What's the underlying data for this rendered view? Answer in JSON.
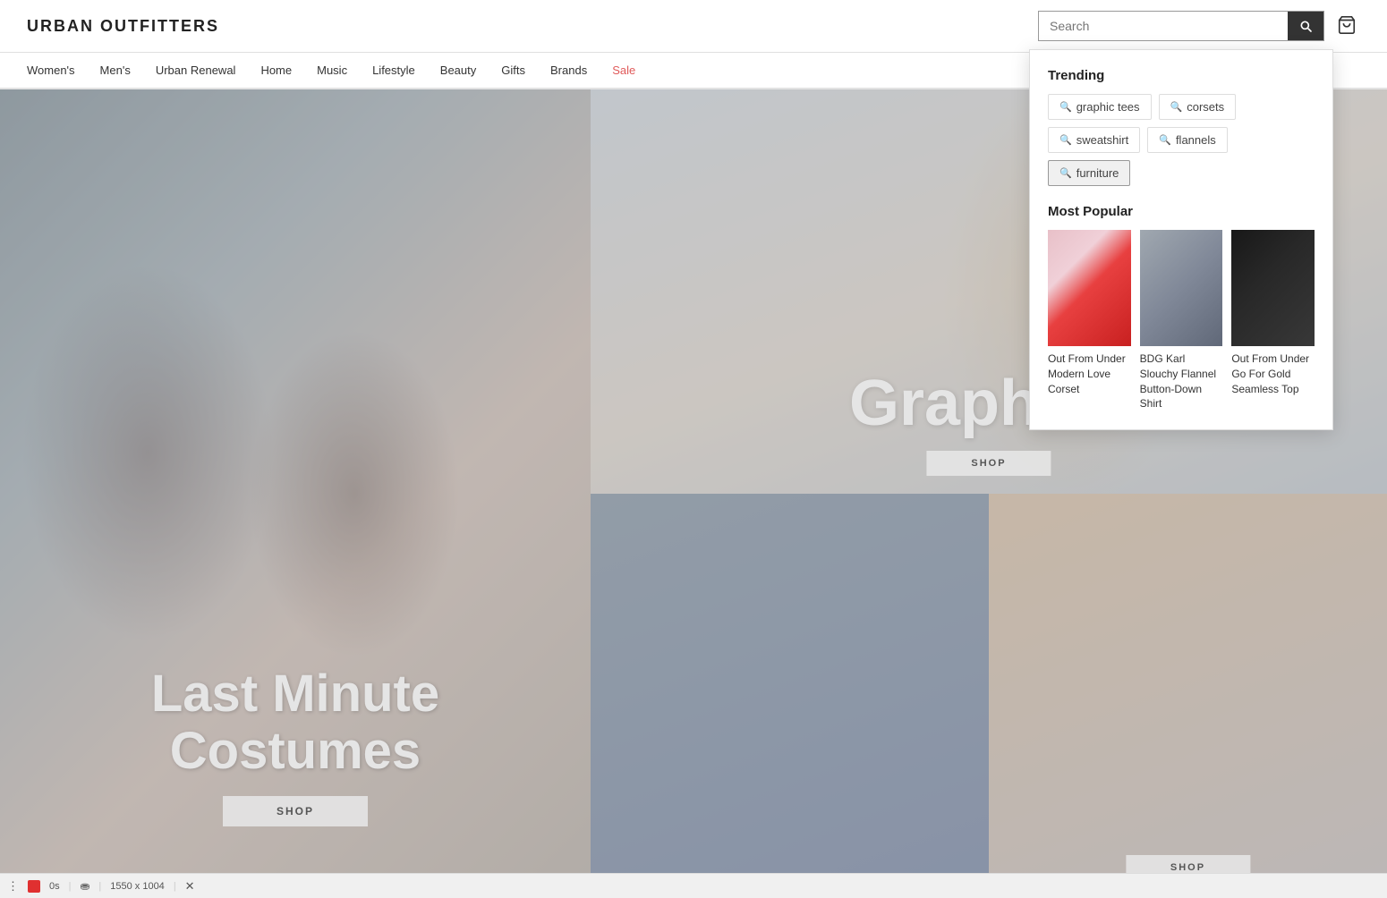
{
  "header": {
    "logo": "URBAN OUTFITTERS",
    "search_placeholder": "Search",
    "cart_icon": "cart-icon"
  },
  "nav": {
    "items": [
      {
        "label": "Women's",
        "id": "womens",
        "sale": false
      },
      {
        "label": "Men's",
        "id": "mens",
        "sale": false
      },
      {
        "label": "Urban Renewal",
        "id": "urban-renewal",
        "sale": false
      },
      {
        "label": "Home",
        "id": "home",
        "sale": false
      },
      {
        "label": "Music",
        "id": "music",
        "sale": false
      },
      {
        "label": "Lifestyle",
        "id": "lifestyle",
        "sale": false
      },
      {
        "label": "Beauty",
        "id": "beauty",
        "sale": false
      },
      {
        "label": "Gifts",
        "id": "gifts",
        "sale": false
      },
      {
        "label": "Brands",
        "id": "brands",
        "sale": false
      },
      {
        "label": "Sale",
        "id": "sale",
        "sale": true
      }
    ]
  },
  "panels": {
    "left": {
      "title_line1": "Last Minute",
      "title_line2": "Costumes",
      "shop_button": "SHOP"
    },
    "right_top": {
      "title": "Graphics",
      "shop_button": "SHOP"
    },
    "right_bottom": {
      "shop_button": "SHOP"
    }
  },
  "search_dropdown": {
    "trending_title": "Trending",
    "tags": [
      {
        "label": "graphic tees",
        "active": false
      },
      {
        "label": "corsets",
        "active": false
      },
      {
        "label": "sweatshirt",
        "active": false
      },
      {
        "label": "flannels",
        "active": false
      },
      {
        "label": "furniture",
        "active": true
      }
    ],
    "most_popular_title": "Most Popular",
    "products": [
      {
        "name": "Out From Under Modern Love Corset",
        "img_class": "product-img-1"
      },
      {
        "name": "BDG Karl Slouchy Flannel Button-Down Shirt",
        "img_class": "product-img-2"
      },
      {
        "name": "Out From Under Go For Gold Seamless Top",
        "img_class": "product-img-3"
      }
    ]
  },
  "status_bar": {
    "count": "0s",
    "dimensions": "1550 x 1004"
  }
}
